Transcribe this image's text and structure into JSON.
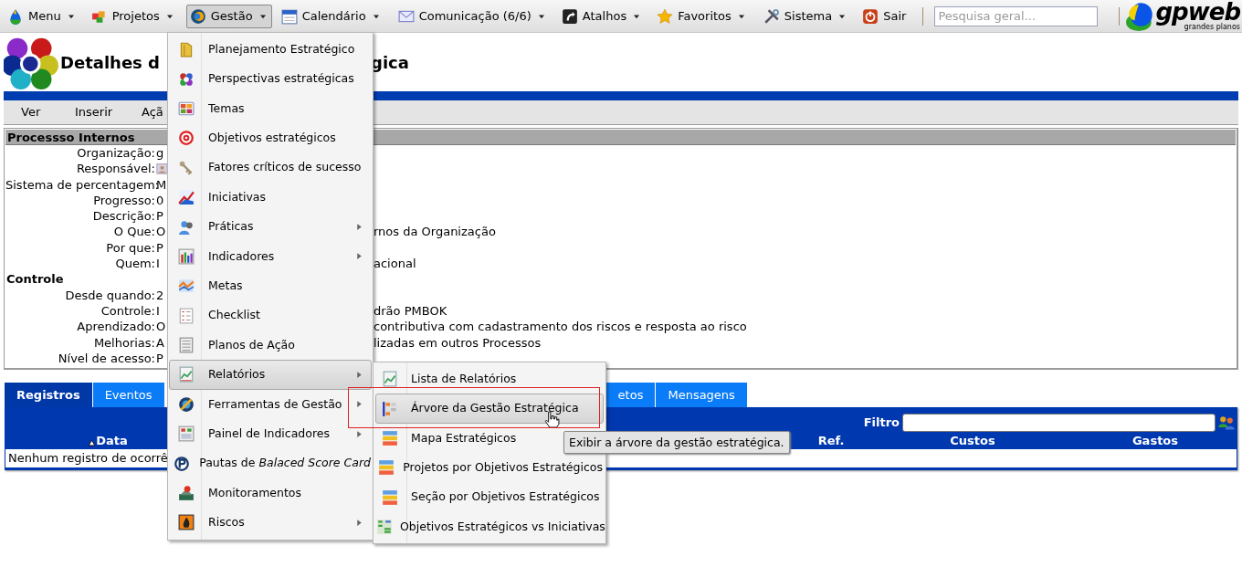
{
  "top_menu": {
    "items": [
      {
        "label": "Menu",
        "selected": false,
        "dropdown": true
      },
      {
        "label": "Projetos",
        "selected": false,
        "dropdown": true
      },
      {
        "label": "Gestão",
        "selected": true,
        "dropdown": true
      },
      {
        "label": "Calendário",
        "selected": false,
        "dropdown": true
      },
      {
        "label": "Comunicação (6/6)",
        "selected": false,
        "dropdown": true
      },
      {
        "label": "Atalhos",
        "selected": false,
        "dropdown": true
      },
      {
        "label": "Favoritos",
        "selected": false,
        "dropdown": true
      },
      {
        "label": "Sistema",
        "selected": false,
        "dropdown": true
      },
      {
        "label": "Sair",
        "selected": false,
        "dropdown": false
      }
    ],
    "search": {
      "placeholder": "Pesquisa geral..."
    },
    "logo": {
      "name": "gpweb",
      "tagline": "grandes planos"
    }
  },
  "page": {
    "title_parts": [
      "Detalhes d",
      "gica"
    ],
    "toolbar": [
      "Ver",
      "Inserir",
      "Açã"
    ]
  },
  "details": {
    "heading": "Processso Internos",
    "rows": [
      {
        "kind": "field",
        "label": "Organização:",
        "value": "g"
      },
      {
        "kind": "person",
        "label": "Responsável:"
      },
      {
        "kind": "field",
        "label": "Sistema de percentagem:",
        "value": "M"
      },
      {
        "kind": "field",
        "label": "Progresso:",
        "value": "0"
      },
      {
        "kind": "field",
        "label": "Descrição:",
        "value": "P"
      },
      {
        "kind": "field",
        "label": "O Que:",
        "value": "O",
        "value_end": "rnos da Organização"
      },
      {
        "kind": "field",
        "label": "Por que:",
        "value": "P"
      },
      {
        "kind": "field",
        "label": "Quem:",
        "value": "I",
        "value_end": "acional"
      },
      {
        "kind": "section",
        "label": "Controle"
      },
      {
        "kind": "field",
        "label": "Desde quando:",
        "value": "2"
      },
      {
        "kind": "field",
        "label": "Controle:",
        "value": "I",
        "value_end": "drão PMBOK"
      },
      {
        "kind": "field",
        "label": "Aprendizado:",
        "value": "O",
        "value_end": "contributiva com cadastramento dos riscos e resposta ao risco"
      },
      {
        "kind": "field",
        "label": "Melhorias:",
        "value": "A",
        "value_end": "lizadas em outros Processos"
      },
      {
        "kind": "field",
        "label": "Nível de acesso:",
        "value": "P"
      }
    ]
  },
  "tabs": [
    {
      "label": "Registros",
      "selected": true
    },
    {
      "label": "Eventos",
      "selected": false
    },
    {
      "label": "etos",
      "selected": false
    },
    {
      "label": "Mensagens",
      "selected": false
    }
  ],
  "records": {
    "filter_label": "Filtro",
    "columns": [
      {
        "label": "Data",
        "sorted": true
      },
      {
        "label": "Ref.",
        "sorted": false
      },
      {
        "label": "Custos",
        "sorted": false
      },
      {
        "label": "Gastos",
        "sorted": false
      }
    ],
    "empty_message": "Nenhum registro de ocorrê"
  },
  "gestao_menu": {
    "items": [
      {
        "label": "Planejamento Estratégico",
        "submenu": false,
        "selected": false
      },
      {
        "label": "Perspectivas estratégicas",
        "submenu": false,
        "selected": false
      },
      {
        "label": "Temas",
        "submenu": false,
        "selected": false
      },
      {
        "label": "Objetivos estratégicos",
        "submenu": false,
        "selected": false
      },
      {
        "label": "Fatores críticos de sucesso",
        "submenu": false,
        "selected": false
      },
      {
        "label": "Iniciativas",
        "submenu": false,
        "selected": false
      },
      {
        "label": "Práticas",
        "submenu": true,
        "selected": false
      },
      {
        "label": "Indicadores",
        "submenu": true,
        "selected": false
      },
      {
        "label": "Metas",
        "submenu": false,
        "selected": false
      },
      {
        "label": "Checklist",
        "submenu": false,
        "selected": false
      },
      {
        "label": "Planos de Ação",
        "submenu": false,
        "selected": false
      },
      {
        "label": "Relatórios",
        "submenu": true,
        "selected": true
      },
      {
        "label": "Ferramentas de Gestão",
        "submenu": true,
        "selected": false
      },
      {
        "label": "Painel de Indicadores",
        "submenu": true,
        "selected": false
      },
      {
        "label": "Pautas de *Balaced Score Card*",
        "submenu": false,
        "selected": false
      },
      {
        "label": "Monitoramentos",
        "submenu": false,
        "selected": false
      },
      {
        "label": "Riscos",
        "submenu": true,
        "selected": false
      }
    ]
  },
  "relatorios_submenu": {
    "items": [
      {
        "label": "Lista de Relatórios",
        "selected": false
      },
      {
        "label": "Árvore da Gestão Estratégica",
        "selected": true
      },
      {
        "label": "Mapa Estratégicos",
        "selected": false
      },
      {
        "label": "Projetos por Objetivos Estratégicos",
        "selected": false
      },
      {
        "label": "Seção por Objetivos Estratégicos",
        "selected": false
      },
      {
        "label": "Objetivos Estratégicos vs Iniciativas",
        "selected": false
      }
    ]
  },
  "tooltip": "Exibir a árvore da gestão estratégica."
}
